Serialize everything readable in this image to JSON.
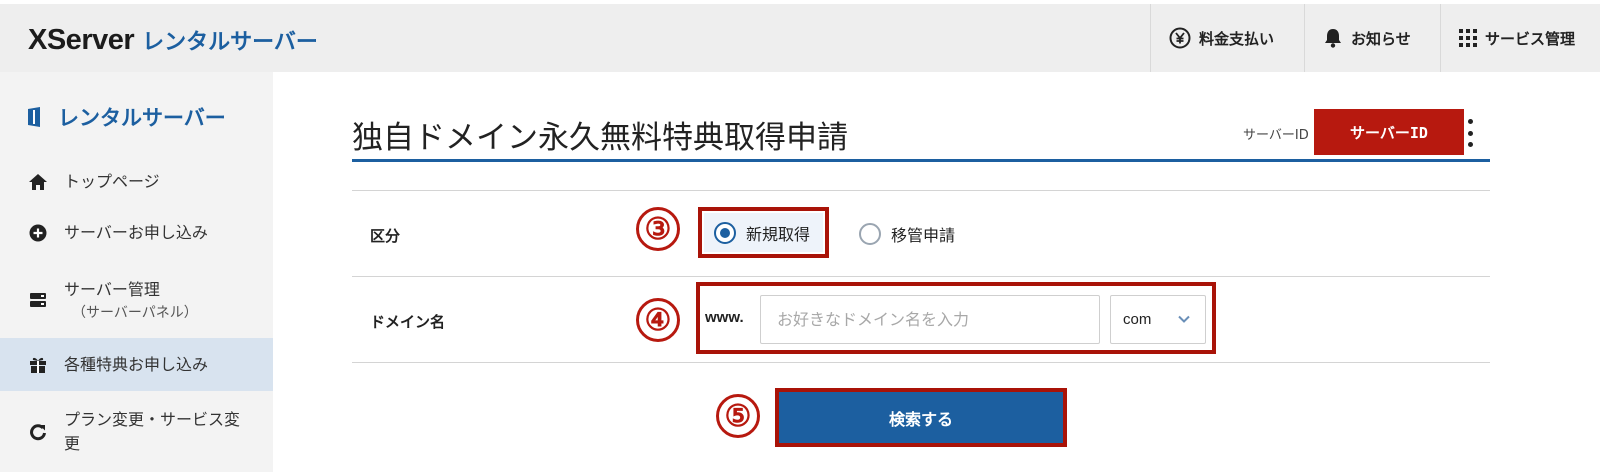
{
  "header": {
    "logo_brand": "XServer",
    "logo_product": "レンタルサーバー",
    "nav": [
      {
        "label": "料金支払い",
        "icon": "yen-circle-icon"
      },
      {
        "label": "お知らせ",
        "icon": "bell-icon"
      },
      {
        "label": "サービス管理",
        "icon": "grid-icon"
      }
    ]
  },
  "sidebar": {
    "title": "レンタルサーバー",
    "items": [
      {
        "label": "トップページ",
        "icon": "home-icon"
      },
      {
        "label": "サーバーお申し込み",
        "icon": "plus-circle-icon"
      },
      {
        "label": "サーバー管理",
        "sub": "（サーバーパネル）",
        "icon": "server-icon"
      },
      {
        "label": "各種特典お申し込み",
        "icon": "gift-icon",
        "active": true
      },
      {
        "label": "プラン変更・サービス変更",
        "icon": "refresh-icon"
      }
    ]
  },
  "main": {
    "title": "独自ドメイン永久無料特典取得申請",
    "server_id_label": "サーバーID",
    "server_id_value": "サーバーID",
    "form": {
      "category_label": "区分",
      "category_options": [
        "新規取得",
        "移管申請"
      ],
      "category_selected": "新規取得",
      "domain_label": "ドメイン名",
      "www_prefix": "www.",
      "domain_placeholder": "お好きなドメイン名を入力",
      "domain_value": "",
      "tld_selected": "com",
      "submit_label": "検索する"
    },
    "steps": [
      "③",
      "④",
      "⑤"
    ]
  },
  "colors": {
    "brand_blue": "#1c5fa0",
    "highlight_red": "#b7190f",
    "sidebar_bg": "#f3f3f3",
    "active_bg": "#d8e3ef"
  }
}
